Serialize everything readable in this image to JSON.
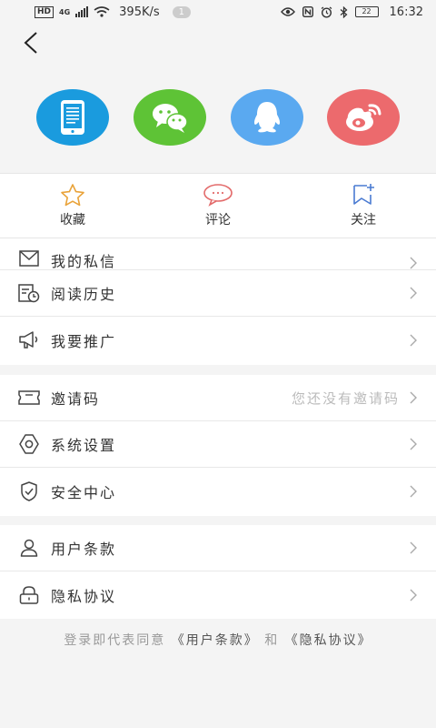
{
  "status_bar": {
    "network_badge": "HD",
    "signal_type": "4G",
    "speed": "395K/s",
    "notification_count": "1",
    "battery": "22",
    "time": "16:32"
  },
  "share_icons": [
    "tablet-icon",
    "wechat-icon",
    "qq-icon",
    "weibo-icon"
  ],
  "colors": {
    "tablet": "#1a9bde",
    "wechat": "#5ec336",
    "qq": "#5aa9f0",
    "weibo": "#ec6a6d",
    "star": "#e9a33a",
    "comment": "#e36b6b",
    "follow": "#4a7bd2"
  },
  "actions": {
    "favorite": "收藏",
    "comment": "评论",
    "follow": "关注"
  },
  "menu": {
    "group1": [
      {
        "label": "我的私信"
      },
      {
        "label": "阅读历史"
      },
      {
        "label": "我要推广"
      }
    ],
    "group2": [
      {
        "label": "邀请码",
        "value": "您还没有邀请码"
      },
      {
        "label": "系统设置"
      },
      {
        "label": "安全中心"
      }
    ],
    "group3": [
      {
        "label": "用户条款"
      },
      {
        "label": "隐私协议"
      }
    ]
  },
  "footer": {
    "prefix": "登录即代表同意",
    "terms": "《用户条款》",
    "and": "和",
    "privacy": "《隐私协议》"
  }
}
